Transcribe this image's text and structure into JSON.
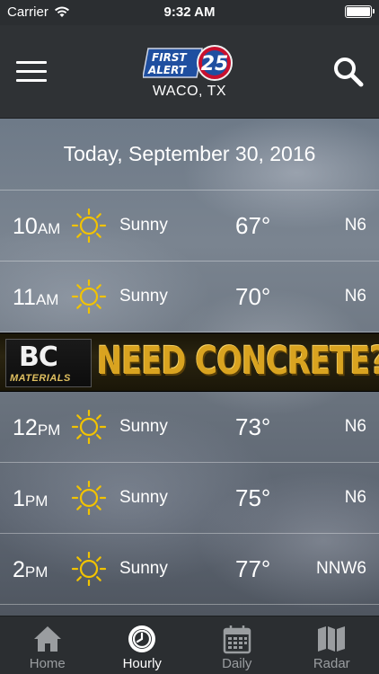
{
  "status_bar": {
    "carrier": "Carrier",
    "time": "9:32 AM"
  },
  "header": {
    "logo_text_1": "FIRST",
    "logo_text_2": "ALERT",
    "logo_number": "25",
    "location": "WACO, TX"
  },
  "date_banner": "Today, September 30, 2016",
  "forecast": [
    {
      "hour": "10",
      "period": "AM",
      "icon": "sun-icon",
      "condition": "Sunny",
      "temp": "67°",
      "wind": "N6"
    },
    {
      "hour": "11",
      "period": "AM",
      "icon": "sun-icon",
      "condition": "Sunny",
      "temp": "70°",
      "wind": "N6"
    },
    {
      "hour": "12",
      "period": "PM",
      "icon": "sun-icon",
      "condition": "Sunny",
      "temp": "73°",
      "wind": "N6"
    },
    {
      "hour": "1",
      "period": "PM",
      "icon": "sun-icon",
      "condition": "Sunny",
      "temp": "75°",
      "wind": "N6"
    },
    {
      "hour": "2",
      "period": "PM",
      "icon": "sun-icon",
      "condition": "Sunny",
      "temp": "77°",
      "wind": "NNW6"
    }
  ],
  "ad": {
    "brand": "BC",
    "brand_sub": "MATERIALS",
    "headline": "NEED CONCRETE?"
  },
  "tabs": [
    {
      "label": "Home",
      "icon": "home-icon"
    },
    {
      "label": "Hourly",
      "icon": "clock-icon",
      "active": true
    },
    {
      "label": "Daily",
      "icon": "calendar-icon"
    },
    {
      "label": "Radar",
      "icon": "map-icon"
    }
  ],
  "colors": {
    "sun": "#f2c300",
    "accent_logo": "#c8102e",
    "logo_blue": "#1f4fa0",
    "ad_gold": "#d9a320"
  }
}
